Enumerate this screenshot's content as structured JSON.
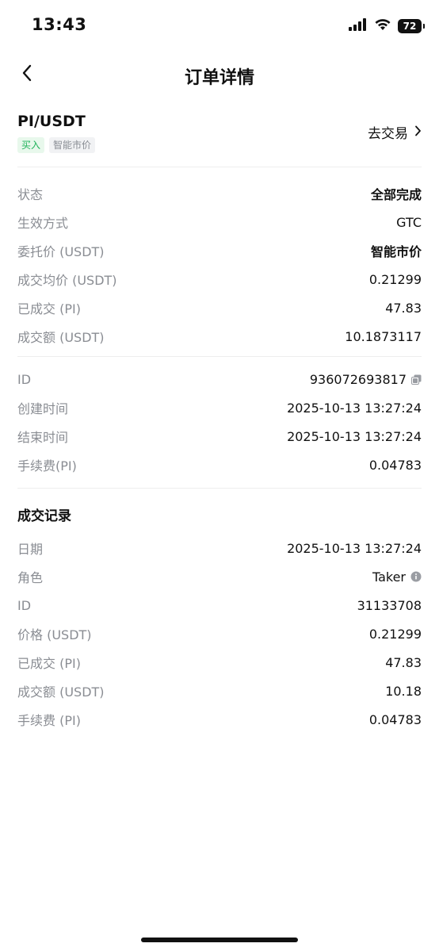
{
  "status_bar": {
    "time": "13:43",
    "battery": "72"
  },
  "nav": {
    "title": "订单详情"
  },
  "pair": {
    "name": "PI/USDT",
    "side_tag": "买入",
    "type_tag": "智能市价",
    "trade_link": "去交易"
  },
  "order_info": [
    {
      "label": "状态",
      "value": "全部完成"
    },
    {
      "label": "生效方式",
      "value": "GTC"
    },
    {
      "label": "委托价 (USDT)",
      "value": "智能市价"
    },
    {
      "label": "成交均价 (USDT)",
      "value": "0.21299"
    },
    {
      "label": "已成交 (PI)",
      "value": "47.83"
    },
    {
      "label": "成交额 (USDT)",
      "value": "10.1873117"
    }
  ],
  "order_meta": [
    {
      "label": "ID",
      "value": "936072693817"
    },
    {
      "label": "创建时间",
      "value": "2025-10-13 13:27:24"
    },
    {
      "label": "结束时间",
      "value": "2025-10-13 13:27:24"
    },
    {
      "label": "手续费(PI)",
      "value": "0.04783"
    }
  ],
  "trade_records": {
    "title": "成交记录",
    "rows": [
      {
        "label": "日期",
        "value": "2025-10-13 13:27:24"
      },
      {
        "label": "角色",
        "value": "Taker"
      },
      {
        "label": "ID",
        "value": "31133708"
      },
      {
        "label": "价格 (USDT)",
        "value": "0.21299"
      },
      {
        "label": "已成交 (PI)",
        "value": "47.83"
      },
      {
        "label": "成交额 (USDT)",
        "value": "10.18"
      },
      {
        "label": "手续费 (PI)",
        "value": "0.04783"
      }
    ]
  }
}
